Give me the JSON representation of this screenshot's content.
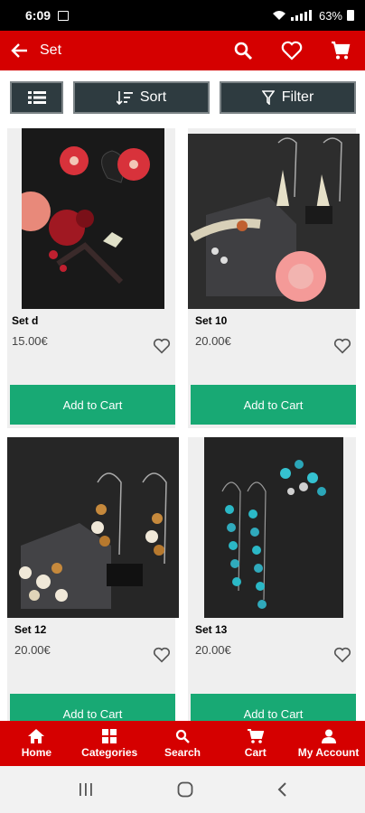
{
  "status": {
    "time": "6:09",
    "battery": "63%"
  },
  "app_bar": {
    "title": "Set"
  },
  "toolbar": {
    "sort_label": "Sort",
    "filter_label": "Filter"
  },
  "products": [
    {
      "name": "Set d",
      "price": "15.00€",
      "button": "Add to Cart"
    },
    {
      "name": "Set 10",
      "price": "20.00€",
      "button": "Add to Cart"
    },
    {
      "name": "Set 12",
      "price": "20.00€",
      "button": "Add to Cart"
    },
    {
      "name": "Set 13",
      "price": "20.00€",
      "button": "Add to Cart"
    }
  ],
  "bottom_nav": [
    {
      "label": "Home",
      "icon": "home-icon"
    },
    {
      "label": "Categories",
      "icon": "categories-icon"
    },
    {
      "label": "Search",
      "icon": "search-icon"
    },
    {
      "label": "Cart",
      "icon": "cart-icon"
    },
    {
      "label": "My Account",
      "icon": "account-icon"
    }
  ],
  "colors": {
    "brand": "#d50000",
    "add_button": "#18a974",
    "toolbar_button": "#2e3b40"
  }
}
